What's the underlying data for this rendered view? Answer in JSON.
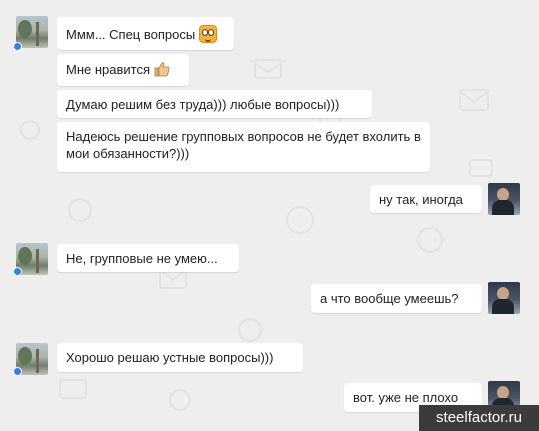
{
  "colors": {
    "background": "#eeeeee",
    "bubble": "#ffffff",
    "online_dot": "#3b7de0",
    "watermark_bg": "#3b3b3b"
  },
  "messages": [
    {
      "side": "left",
      "text": "Ммм... Спец вопросы",
      "emoji": "laughing-face-icon"
    },
    {
      "side": "left",
      "text": "Мне нравится",
      "emoji": "thumbs-up-icon"
    },
    {
      "side": "left",
      "text": "Думаю решим без труда))) любые вопросы)))"
    },
    {
      "side": "left",
      "text": "Надеюсь решение групповых вопросов не будет вхолить в мои обязанности?)))"
    },
    {
      "side": "right",
      "text": "ну так, иногда"
    },
    {
      "side": "left",
      "text": "Не, групповые не умею..."
    },
    {
      "side": "right",
      "text": "а что вообще умеешь?"
    },
    {
      "side": "left",
      "text": "Хорошо решаю устные вопросы)))"
    },
    {
      "side": "right",
      "text": "вот. уже не плохо"
    }
  ],
  "watermark": "steelfactor.ru"
}
